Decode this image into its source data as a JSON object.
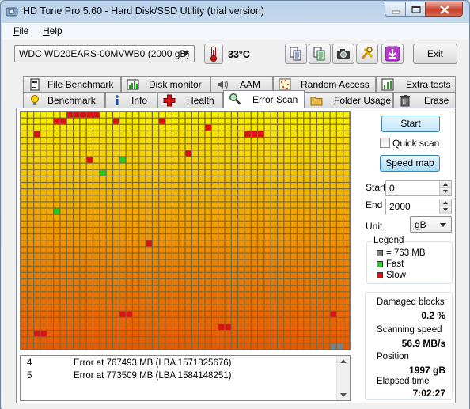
{
  "window": {
    "title": "HD Tune Pro 5.60 - Hard Disk/SSD Utility (trial version)"
  },
  "menu": [
    {
      "label": "File",
      "mnemonic": "F",
      "rest": "ile"
    },
    {
      "label": "Help",
      "mnemonic": "H",
      "rest": "elp"
    }
  ],
  "toolbar": {
    "drive": "WDC WD20EARS-00MVWB0 (2000 gB)",
    "temperature": "33°C",
    "exit_label": "Exit",
    "icons": [
      "copy-text-icon",
      "copy-info-icon",
      "screenshot-camera-icon",
      "options-tools-icon",
      "save-download-icon"
    ]
  },
  "tabs_top": [
    {
      "label": "File Benchmark",
      "icon": "file-benchmark-icon"
    },
    {
      "label": "Disk monitor",
      "icon": "disk-monitor-icon"
    },
    {
      "label": "AAM",
      "icon": "speaker-icon"
    },
    {
      "label": "Random Access",
      "icon": "random-access-icon"
    },
    {
      "label": "Extra tests",
      "icon": "extra-tests-icon"
    }
  ],
  "tabs_bottom": [
    {
      "label": "Benchmark",
      "icon": "benchmark-bulb-icon"
    },
    {
      "label": "Info",
      "icon": "info-icon"
    },
    {
      "label": "Health",
      "icon": "health-cross-icon"
    },
    {
      "label": "Error Scan",
      "icon": "magnifier-icon",
      "active": true
    },
    {
      "label": "Folder Usage",
      "icon": "folder-icon"
    },
    {
      "label": "Erase",
      "icon": "trash-icon"
    }
  ],
  "controls": {
    "start_label": "Start",
    "quick_scan_label": "Quick scan",
    "quick_scan_checked": false,
    "speed_map_label": "Speed map",
    "start_field_label": "Start",
    "start_value": "0",
    "end_field_label": "End",
    "end_value": "2000",
    "unit_label": "Unit",
    "unit_value": "gB"
  },
  "legend": {
    "title": "Legend",
    "block": "= 763 MB",
    "fast": "Fast",
    "slow": "Slow",
    "colors": {
      "block": "#808080",
      "fast": "#22cc22",
      "slow": "#dd1111"
    }
  },
  "stats": {
    "damaged_label": "Damaged blocks",
    "damaged_value": "0.2 %",
    "speed_label": "Scanning speed",
    "speed_value": "56.9 MB/s",
    "position_label": "Position",
    "position_value": "1997 gB",
    "elapsed_label": "Elapsed time",
    "elapsed_value": "7:02:27"
  },
  "log": [
    {
      "num": "4",
      "msg": "Error at 767493 MB (LBA 1571825676)"
    },
    {
      "num": "5",
      "msg": "Error at 773509 MB (LBA 1584148251)"
    }
  ],
  "scan_grid": {
    "columns": 50,
    "rows": 37,
    "gradient": [
      "#f7f000",
      "#f4b500",
      "#ee7e00",
      "#e85a00"
    ],
    "green_blocks": [
      [
        12,
        9
      ],
      [
        15,
        7
      ],
      [
        5,
        15
      ]
    ],
    "red_blocks": [
      [
        7,
        0
      ],
      [
        8,
        0
      ],
      [
        9,
        0
      ],
      [
        10,
        0
      ],
      [
        11,
        0
      ],
      [
        5,
        1
      ],
      [
        6,
        1
      ],
      [
        14,
        1
      ],
      [
        21,
        1
      ],
      [
        2,
        3
      ],
      [
        34,
        3
      ],
      [
        35,
        3
      ],
      [
        36,
        3
      ],
      [
        28,
        2
      ],
      [
        25,
        6
      ],
      [
        10,
        7
      ],
      [
        19,
        20
      ],
      [
        15,
        31
      ],
      [
        16,
        31
      ],
      [
        47,
        31
      ],
      [
        30,
        33
      ],
      [
        31,
        33
      ],
      [
        2,
        34
      ],
      [
        3,
        34
      ]
    ],
    "gray_blocks": [
      [
        47,
        36
      ],
      [
        48,
        36
      ]
    ]
  }
}
